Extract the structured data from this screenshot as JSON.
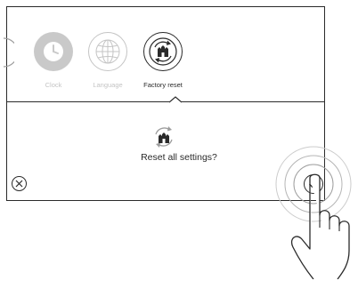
{
  "carousel": {
    "items": [
      {
        "label": "Clock",
        "icon": "clock-icon",
        "state": "dimmed"
      },
      {
        "label": "Language",
        "icon": "globe-icon",
        "state": "dimmed"
      },
      {
        "label": "Factory reset",
        "icon": "factory-reset-icon",
        "state": "selected"
      }
    ]
  },
  "dialog": {
    "message": "Reset all settings?",
    "icon": "factory-reset-icon"
  },
  "actions": {
    "cancel_icon": "close-icon",
    "confirm_icon": "check-icon"
  },
  "colors": {
    "line": "#2a2a2a",
    "dimmed": "#c4c4c4",
    "accent_gray": "#9e9e9e"
  }
}
